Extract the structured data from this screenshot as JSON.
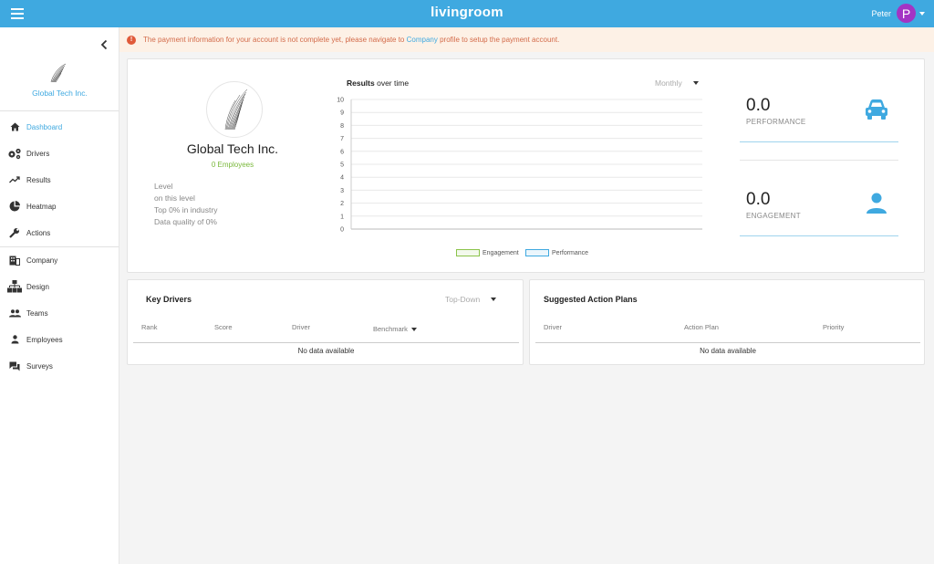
{
  "app": {
    "title": "livingroom"
  },
  "topbar": {
    "menu_icon": "hamburger-icon",
    "user_name": "Peter",
    "avatar_letter": "P",
    "accent": "#3fa9e0",
    "avatar_color": "#a334c4"
  },
  "sidebar": {
    "org_name": "Global Tech Inc.",
    "items": [
      {
        "label": "Dashboard",
        "icon": "home-icon",
        "active": true
      },
      {
        "label": "Drivers",
        "icon": "gears-icon"
      },
      {
        "label": "Results",
        "icon": "trending-up-icon"
      },
      {
        "label": "Heatmap",
        "icon": "pie-chart-icon"
      },
      {
        "label": "Actions",
        "icon": "wrench-icon"
      },
      {
        "label": "Company",
        "icon": "building-icon"
      },
      {
        "label": "Design",
        "icon": "org-chart-icon"
      },
      {
        "label": "Teams",
        "icon": "group-icon"
      },
      {
        "label": "Employees",
        "icon": "person-icon"
      },
      {
        "label": "Surveys",
        "icon": "chat-icon"
      }
    ]
  },
  "alert": {
    "text_before": "The payment information for your account is not complete yet, please navigate to",
    "link": "Company",
    "text_after": "profile to setup the payment account."
  },
  "company": {
    "name": "Global Tech Inc.",
    "employees": "0 Employees",
    "stats": [
      "Level",
      "on this level",
      "Top 0% in industry",
      "Data quality of 0%"
    ]
  },
  "results_chart": {
    "title_bold": "Results",
    "title_rest": "over time",
    "period": "Monthly"
  },
  "chart_data": {
    "type": "line",
    "title": "Results over time",
    "y_ticks": [
      "0",
      "1",
      "2",
      "3",
      "4",
      "5",
      "6",
      "7",
      "8",
      "9",
      "10"
    ],
    "ylim": [
      0,
      10
    ],
    "grid": true,
    "legend_position": "bottom",
    "series": [
      {
        "name": "Engagement",
        "values": [],
        "color": "#8bc34a"
      },
      {
        "name": "Performance",
        "values": [],
        "color": "#3fa9e0"
      }
    ]
  },
  "metrics": {
    "performance": {
      "value": "0.0",
      "label": "PERFORMANCE",
      "icon": "car-icon"
    },
    "engagement": {
      "value": "0.0",
      "label": "ENGAGEMENT",
      "icon": "person-icon"
    }
  },
  "key_drivers": {
    "title": "Key Drivers",
    "view": "Top-Down",
    "columns": [
      "Rank",
      "Score",
      "Driver",
      "Benchmark"
    ],
    "empty": "No data available"
  },
  "action_plans": {
    "title": "Suggested Action Plans",
    "columns": [
      "Driver",
      "Action Plan",
      "Priority"
    ],
    "empty": "No data available"
  }
}
